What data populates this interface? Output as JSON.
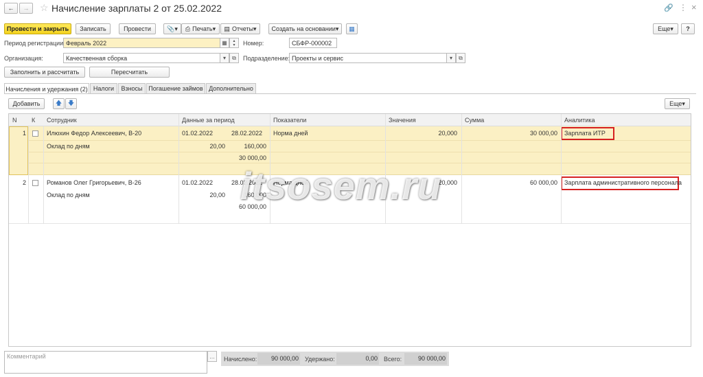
{
  "title": "Начисление зарплаты 2 от 25.02.2022",
  "toolbar": {
    "post_close": "Провести и закрыть",
    "save": "Записать",
    "post": "Провести",
    "print": "Печать",
    "reports": "Отчеты",
    "create_based": "Создать на основании",
    "more": "Еще",
    "help": "?"
  },
  "form": {
    "period_label": "Период регистрации:",
    "period_value": "Февраль 2022",
    "number_label": "Номер:",
    "number_value": "СБФР-000002",
    "org_label": "Организация:",
    "org_value": "Качественная сборка",
    "dept_label": "Подразделение:",
    "dept_value": "Проекты и сервис"
  },
  "actions": {
    "fill": "Заполнить и рассчитать",
    "recalc": "Пересчитать"
  },
  "tabs": [
    "Начисления и удержания (2)",
    "Налоги",
    "Взносы",
    "Погашение займов",
    "Дополнительно"
  ],
  "table_toolbar": {
    "add": "Добавить",
    "more": "Еще"
  },
  "columns": {
    "n": "N",
    "k": "К",
    "employee": "Сотрудник",
    "period": "Данные за период",
    "indicators": "Показатели",
    "values": "Значения",
    "sum": "Сумма",
    "analytics": "Аналитика"
  },
  "rows": [
    {
      "n": "1",
      "employee": "Илюхин Федор Алексеевич, В-20",
      "accrual": "Оклад по дням",
      "date_from": "01.02.2022",
      "date_to": "28.02.2022",
      "days": "20,00",
      "rate": "160,000",
      "result": "30 000,00",
      "indicator": "Норма дней",
      "value": "20,000",
      "sum": "30 000,00",
      "analytics": "Зарплата ИТР"
    },
    {
      "n": "2",
      "employee": "Романов Олег Григорьевич, В-26",
      "accrual": "Оклад по дням",
      "date_from": "01.02.2022",
      "date_to": "28.02.2022",
      "days": "20,00",
      "rate": "160,000",
      "result": "60 000,00",
      "indicator": "Норма дней",
      "value": "20,000",
      "sum": "60 000,00",
      "analytics": "Зарплата административного персонала"
    }
  ],
  "watermark": "itsosem.ru",
  "footer": {
    "comment_placeholder": "Комментарий",
    "accrued_label": "Начислено:",
    "accrued_value": "90 000,00",
    "withheld_label": "Удержано:",
    "withheld_value": "0,00",
    "total_label": "Всего:",
    "total_value": "90 000,00"
  },
  "colors": {
    "accent": "#f4d31e",
    "selected_row": "#fbf0c4",
    "highlight_border": "#d62020"
  }
}
